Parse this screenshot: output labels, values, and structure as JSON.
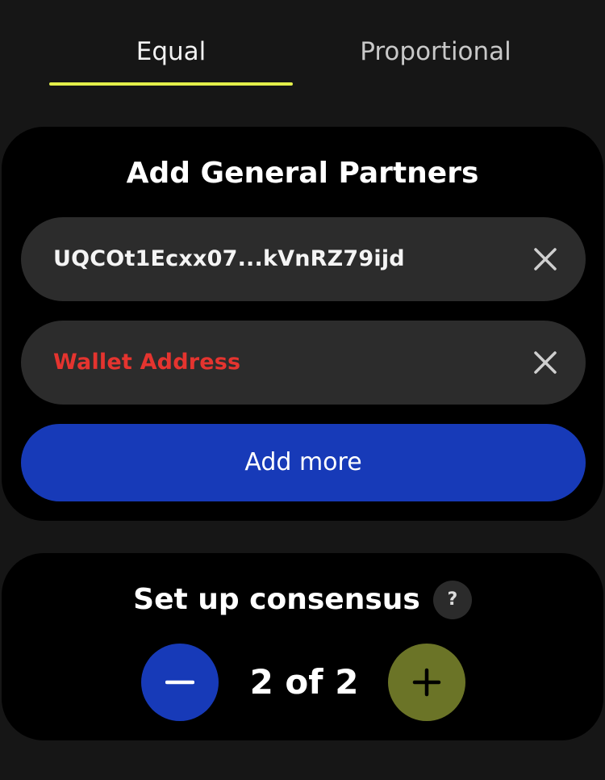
{
  "tabs": {
    "items": [
      {
        "label": "Equal",
        "selected": true
      },
      {
        "label": "Proportional",
        "selected": false
      }
    ],
    "accent_color": "#e3ef4a"
  },
  "partners": {
    "title": "Add General Partners",
    "fields": [
      {
        "value": "UQCOt1Ecxx07...kVnRZ79ijd",
        "clear_icon": "close-icon"
      },
      {
        "placeholder": "Wallet Address",
        "clear_icon": "close-icon"
      }
    ],
    "add_more_label": "Add more",
    "add_more_color": "#173ab8",
    "placeholder_color": "#e5342f"
  },
  "consensus": {
    "title": "Set up consensus",
    "help_label": "?",
    "current": "2",
    "separator": "of",
    "total": "2",
    "decrement_icon": "minus-icon",
    "increment_icon": "plus-icon",
    "decrement_color": "#173ab8",
    "increment_color": "#6b7427"
  }
}
